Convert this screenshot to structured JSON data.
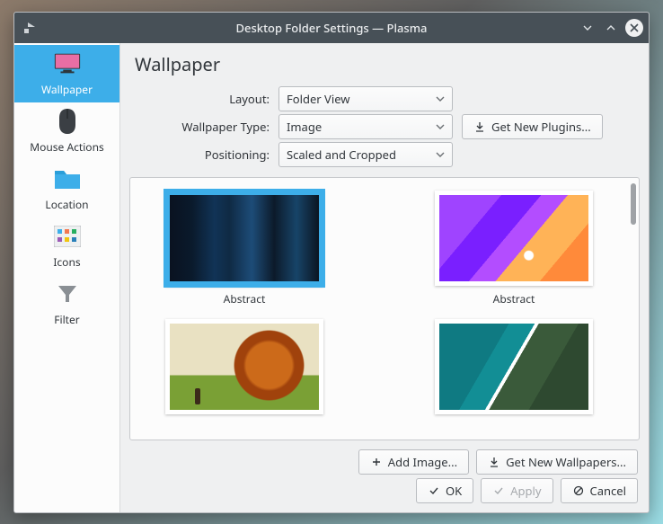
{
  "window": {
    "title": "Desktop Folder Settings — Plasma"
  },
  "sidebar": {
    "items": [
      {
        "label": "Wallpaper"
      },
      {
        "label": "Mouse Actions"
      },
      {
        "label": "Location"
      },
      {
        "label": "Icons"
      },
      {
        "label": "Filter"
      }
    ]
  },
  "page": {
    "title": "Wallpaper"
  },
  "form": {
    "layout": {
      "label": "Layout:",
      "value": "Folder View"
    },
    "wallpaper_type": {
      "label": "Wallpaper Type:",
      "value": "Image"
    },
    "positioning": {
      "label": "Positioning:",
      "value": "Scaled and Cropped"
    }
  },
  "buttons": {
    "get_plugins": "Get New Plugins...",
    "add_image": "Add Image...",
    "get_wallpapers": "Get New Wallpapers...",
    "ok": "OK",
    "apply": "Apply",
    "cancel": "Cancel"
  },
  "wallpapers": [
    {
      "name": "Abstract",
      "selected": true
    },
    {
      "name": "Abstract",
      "selected": false
    },
    {
      "name": "",
      "selected": false
    },
    {
      "name": "",
      "selected": false
    }
  ]
}
